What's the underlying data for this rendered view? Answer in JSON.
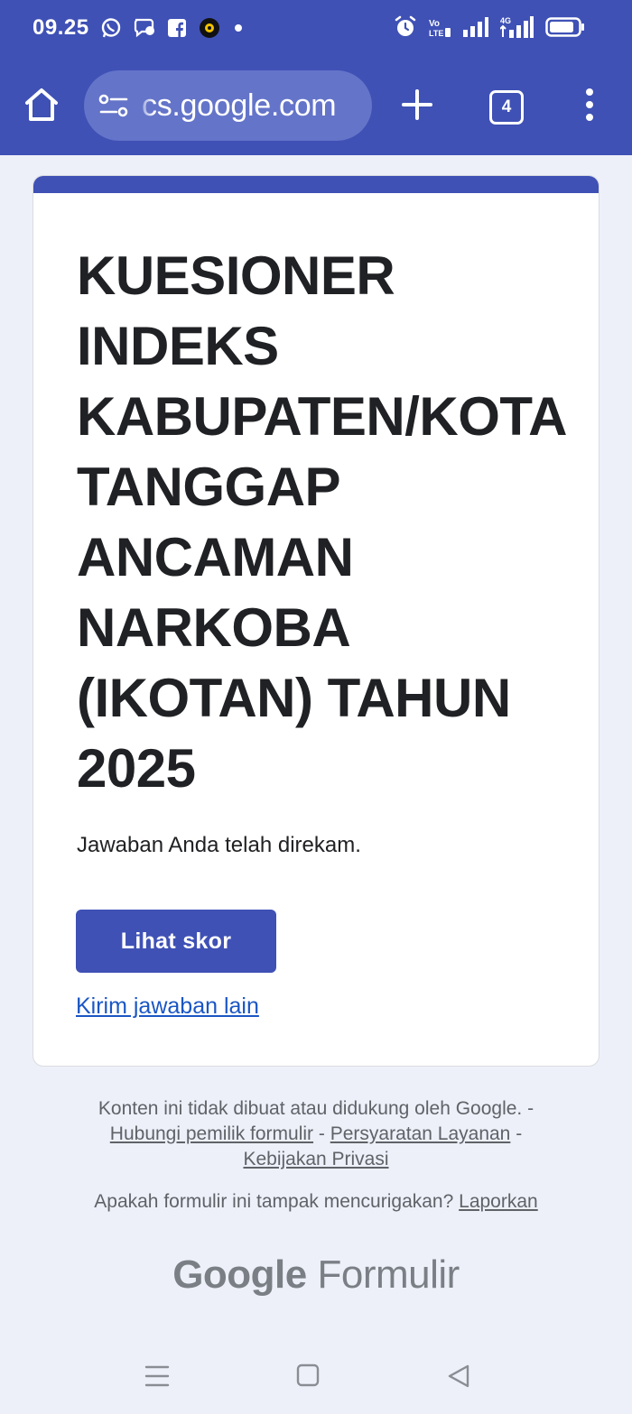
{
  "status_bar": {
    "time": "09.25",
    "notification_icons": [
      "whatsapp-icon",
      "messenger-icon",
      "facebook-icon",
      "app-icon",
      "dot-icon"
    ],
    "system_icons": [
      "alarm-icon",
      "volte-icon",
      "signal-icon",
      "4g-signal-icon",
      "battery-icon"
    ],
    "volte_label": "Vo LTE",
    "network_label": "4G"
  },
  "browser": {
    "url": "cs.google.com",
    "tab_count": "4"
  },
  "form": {
    "title": "KUESIONER INDEKS KABUPATEN/KOTA TANGGAP ANCAMAN NARKOBA (IKOTAN) TAHUN 2025",
    "confirmation": "Jawaban Anda telah direkam.",
    "view_score_label": "Lihat skor",
    "resubmit_label": "Kirim jawaban lain",
    "accent_color": "#3f51b5"
  },
  "footer": {
    "disclaimer": "Konten ini tidak dibuat atau didukung oleh Google. -",
    "contact_owner": "Hubungi pemilik formulir",
    "sep1": " - ",
    "terms": "Persyaratan Layanan",
    "sep2": " -",
    "privacy": "Kebijakan Privasi",
    "report_question": "Apakah formulir ini tampak mencurigakan?",
    "report_link": "Laporkan",
    "brand_google": "Google",
    "brand_product": "Formulir"
  }
}
